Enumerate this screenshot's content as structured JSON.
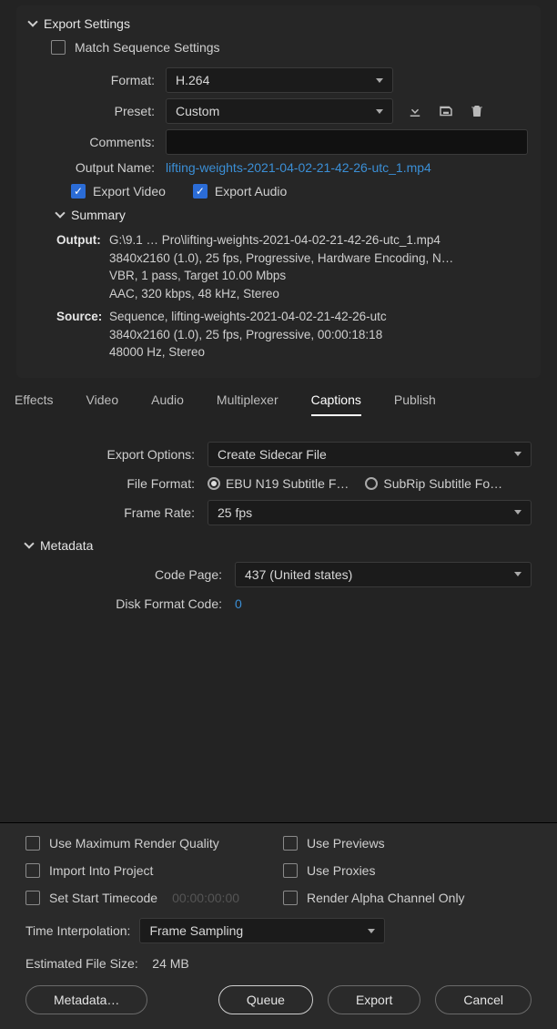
{
  "exportSettings": {
    "title": "Export Settings",
    "matchSeq": "Match Sequence Settings",
    "formatLabel": "Format:",
    "format": "H.264",
    "presetLabel": "Preset:",
    "preset": "Custom",
    "commentsLabel": "Comments:",
    "comments": "",
    "outputNameLabel": "Output Name:",
    "outputName": "lifting-weights-2021-04-02-21-42-26-utc_1.mp4",
    "exportVideo": "Export Video",
    "exportAudio": "Export Audio",
    "summaryTitle": "Summary",
    "outLabel": "Output:",
    "outLine1": "G:\\9.1 … Pro\\lifting-weights-2021-04-02-21-42-26-utc_1.mp4",
    "outLine2": "3840x2160 (1.0), 25 fps, Progressive, Hardware Encoding, N…",
    "outLine3": "VBR, 1 pass, Target 10.00 Mbps",
    "outLine4": "AAC, 320 kbps, 48 kHz, Stereo",
    "srcLabel": "Source:",
    "srcLine1": "Sequence, lifting-weights-2021-04-02-21-42-26-utc",
    "srcLine2": "3840x2160 (1.0), 25 fps, Progressive, 00:00:18:18",
    "srcLine3": "48000 Hz, Stereo"
  },
  "tabs": {
    "effects": "Effects",
    "video": "Video",
    "audio": "Audio",
    "multiplexer": "Multiplexer",
    "captions": "Captions",
    "publish": "Publish"
  },
  "captions": {
    "exportOptionsLabel": "Export Options:",
    "exportOptions": "Create Sidecar File",
    "fileFormatLabel": "File Format:",
    "fmt1": "EBU N19 Subtitle F…",
    "fmt2": "SubRip Subtitle Fo…",
    "frameRateLabel": "Frame Rate:",
    "frameRate": "25 fps",
    "metadataTitle": "Metadata",
    "codePageLabel": "Code Page:",
    "codePage": "437 (United states)",
    "diskFormatLabel": "Disk Format Code:",
    "diskFormat": "0"
  },
  "bottom": {
    "maxRender": "Use Maximum Render Quality",
    "previews": "Use Previews",
    "importProj": "Import Into Project",
    "proxies": "Use Proxies",
    "setStart": "Set Start Timecode",
    "tcPlaceholder": "00:00:00:00",
    "alpha": "Render Alpha Channel Only",
    "timeInterpLabel": "Time Interpolation:",
    "timeInterp": "Frame Sampling",
    "estLabel": "Estimated File Size:",
    "estVal": "24 MB",
    "metadataBtn": "Metadata…",
    "queue": "Queue",
    "export": "Export",
    "cancel": "Cancel"
  }
}
